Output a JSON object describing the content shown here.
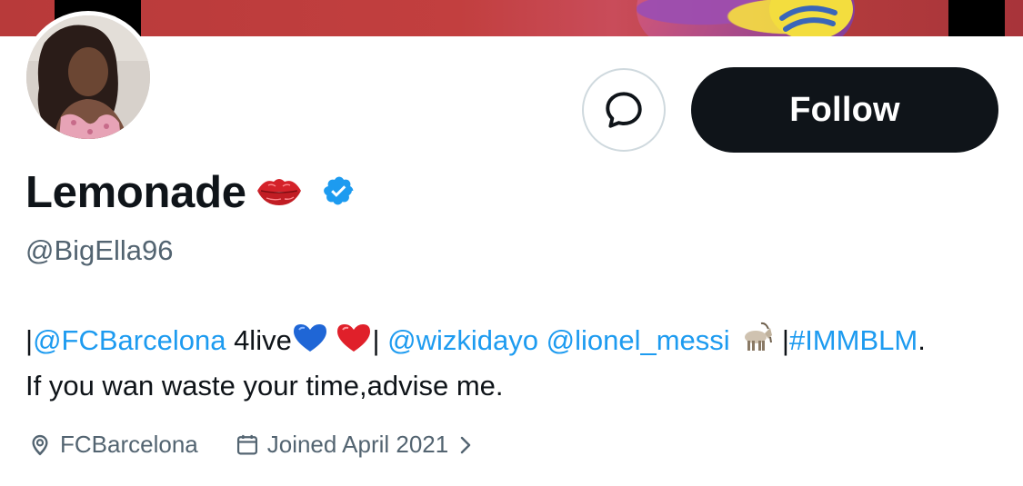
{
  "profile": {
    "display_name": "Lemonade",
    "handle": "@BigElla96",
    "verified": true,
    "name_emoji": "kiss-mark-icon"
  },
  "actions": {
    "follow_label": "Follow",
    "message_icon": "message-bubble-icon"
  },
  "bio": {
    "pipe1": "|",
    "mention_fcb": "@FCBarcelona",
    "text_4live": " 4live",
    "pipe2": "| ",
    "mention_wizkid": "@wizkidayo",
    "space1": " ",
    "mention_messi": "@lionel_messi",
    "pipe3": " |",
    "hashtag": "#IMMBLM",
    "period": ".",
    "line2": "If you wan waste your time,advise me."
  },
  "meta": {
    "location": "FCBarcelona",
    "joined": "Joined April 2021"
  },
  "colors": {
    "link": "#1d9bf0",
    "secondary_text": "#536471",
    "primary_text": "#0f1419",
    "follow_bg": "#0f1419"
  }
}
